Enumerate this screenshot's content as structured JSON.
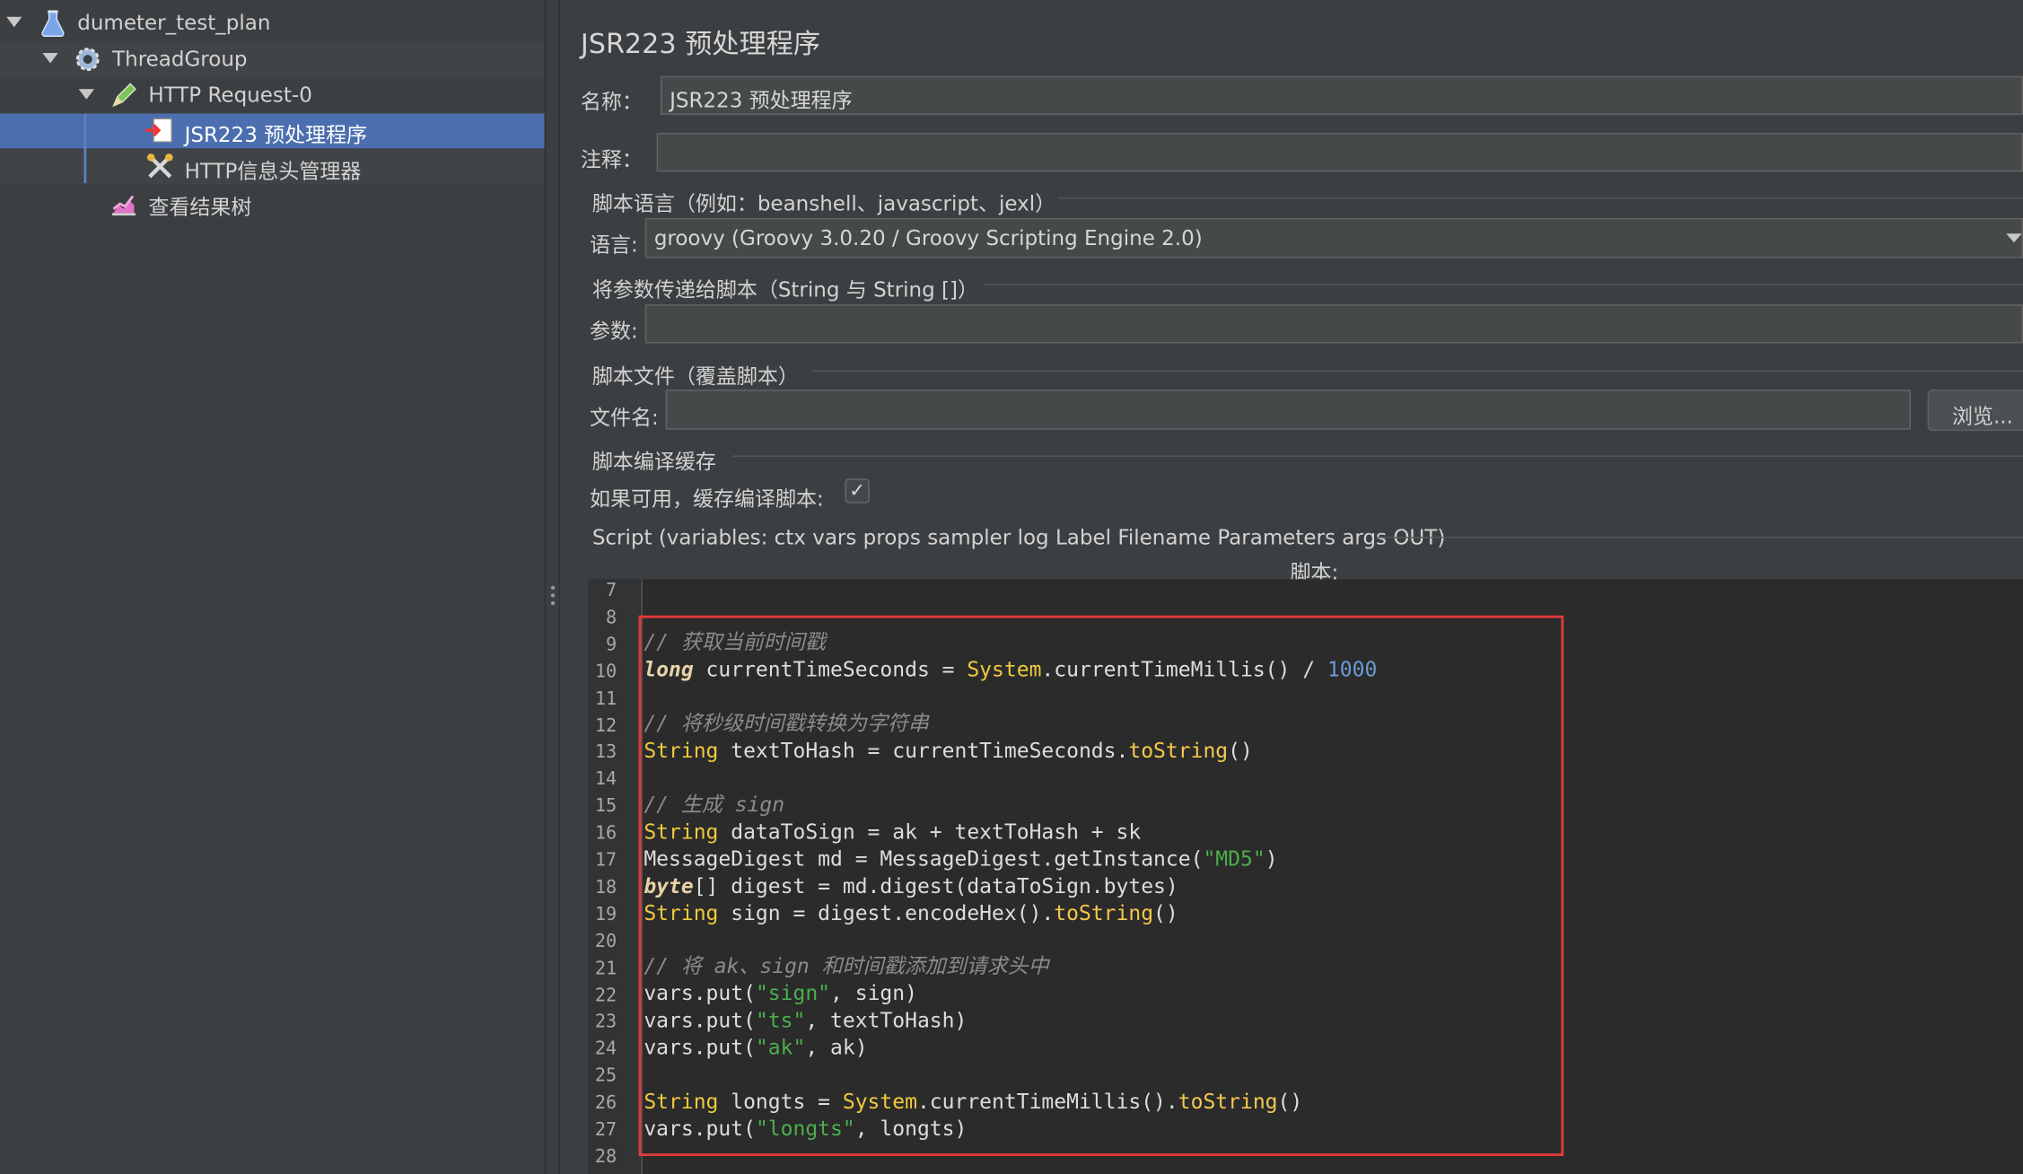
{
  "tree": {
    "items": [
      {
        "label": "dumeter_test_plan",
        "icon": "flask-icon"
      },
      {
        "label": "ThreadGroup",
        "icon": "gear-icon"
      },
      {
        "label": "HTTP Request-0",
        "icon": "pencil-icon"
      },
      {
        "label": "JSR223 预处理程序",
        "icon": "script-icon",
        "selected": true
      },
      {
        "label": "HTTP信息头管理器",
        "icon": "tools-icon"
      },
      {
        "label": "查看结果树",
        "icon": "chart-icon"
      }
    ]
  },
  "panel": {
    "title": "JSR223 预处理程序",
    "name_label": "名称：",
    "name_value": "JSR223 预处理程序",
    "comment_label": "注释：",
    "comment_value": "",
    "lang_section": "脚本语言（例如：beanshell、javascript、jexl）",
    "lang_label": "语言:",
    "lang_value": "groovy     (Groovy 3.0.20 / Groovy Scripting Engine 2.0)",
    "params_section": "将参数传递给脚本（String 与 String []）",
    "params_label": "参数:",
    "params_value": "",
    "file_section": "脚本文件（覆盖脚本）",
    "file_label": "文件名:",
    "file_value": "",
    "browse_label": "浏览...",
    "cache_section": "脚本编译缓存",
    "cache_label": "如果可用，缓存编译脚本:",
    "cache_checked": true,
    "script_section": "Script (variables: ctx vars props sampler log Label Filename Parameters args OUT)",
    "script_label": "脚本:"
  },
  "editor": {
    "lines": [
      {
        "n": "7",
        "text": ""
      },
      {
        "n": "8",
        "text": ""
      },
      {
        "n": "9",
        "text": "// 获取当前时间戳"
      },
      {
        "n": "10",
        "text": "long currentTimeSeconds = System.currentTimeMillis() / 1000"
      },
      {
        "n": "11",
        "text": ""
      },
      {
        "n": "12",
        "text": "// 将秒级时间戳转换为字符串"
      },
      {
        "n": "13",
        "text": "String textToHash = currentTimeSeconds.toString()"
      },
      {
        "n": "14",
        "text": ""
      },
      {
        "n": "15",
        "text": "// 生成 sign"
      },
      {
        "n": "16",
        "text": "String dataToSign = ak + textToHash + sk"
      },
      {
        "n": "17",
        "text": "MessageDigest md = MessageDigest.getInstance(\"MD5\")"
      },
      {
        "n": "18",
        "text": "byte[] digest = md.digest(dataToSign.bytes)"
      },
      {
        "n": "19",
        "text": "String sign = digest.encodeHex().toString()"
      },
      {
        "n": "20",
        "text": ""
      },
      {
        "n": "21",
        "text": "// 将 ak、sign 和时间戳添加到请求头中"
      },
      {
        "n": "22",
        "text": "vars.put(\"sign\", sign)"
      },
      {
        "n": "23",
        "text": "vars.put(\"ts\", textToHash)"
      },
      {
        "n": "24",
        "text": "vars.put(\"ak\", ak)"
      },
      {
        "n": "25",
        "text": ""
      },
      {
        "n": "26",
        "text": "String longts = System.currentTimeMillis().toString()"
      },
      {
        "n": "27",
        "text": "vars.put(\"longts\", longts)"
      },
      {
        "n": "28",
        "text": ""
      }
    ]
  },
  "colors": {
    "selection": "#4b6eaf",
    "highlight_box": "#e13a3a",
    "keyword": "#f0c93e",
    "string": "#4cae4c",
    "number": "#6b9bd6",
    "comment": "#8b8b8b"
  }
}
